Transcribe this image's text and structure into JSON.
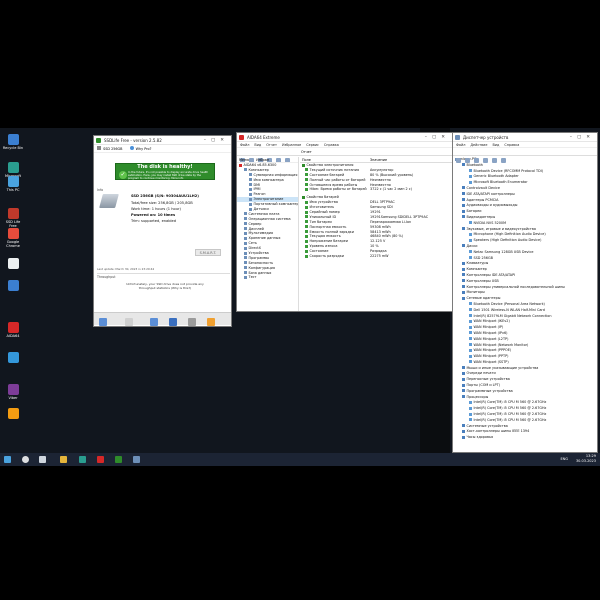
{
  "desktop_icons": [
    {
      "label": "Recycle Bin",
      "color": "#3b7fd1"
    },
    {
      "label": "Microsoft Edge",
      "color": "#2a9d8f"
    },
    {
      "label": "This PC",
      "color": "#4aa3df"
    },
    {
      "label": "SSD Life Free",
      "color": "#c0392b"
    },
    {
      "label": "Google Chrome",
      "color": "#e74c3c"
    },
    {
      "label": "",
      "color": "#ecf0f1"
    },
    {
      "label": "",
      "color": "#3b7fd1"
    },
    {
      "label": "AIDA64",
      "color": "#d62828"
    },
    {
      "label": "",
      "color": "#3498db"
    },
    {
      "label": "Viber",
      "color": "#7d3c98"
    },
    {
      "label": "",
      "color": "#f39c12"
    }
  ],
  "ssd_window": {
    "title": "SSDLife Free - version 2.5.82",
    "tabs": [
      "SSD 256GB",
      "Why Pro?"
    ],
    "status_title": "The disk is healthy!",
    "status_text": "In the future, it's not possible to display accurate drive health estimation. Here, you may install SSD drive state by the program to continue monitoring. More info",
    "info_label": "Info",
    "drive_name": "SSD 256GB (S/N: 90304AUU1LH2)",
    "total_free": "Total/free size: 256,8GB / 205,8GB",
    "work_time": "Work time: 1 hours (1 hour)",
    "powered_on": "Powered on: 10 times",
    "trim": "Trim: supported, enabled",
    "smart_btn": "S.M.A.R.T.",
    "last_update": "Last update: March 30, 2023 in 23:29:44",
    "throughput_label": "Throughput",
    "throughput_text": "Unfortunately, your SSD drive does not provide any throughput statistics (Why is this?)"
  },
  "aida_window": {
    "title": "AIDA64 Extreme",
    "menu": [
      "Файл",
      "Вид",
      "Отчет",
      "Избранное",
      "Сервис",
      "Справка"
    ],
    "left_tabs": [
      "Меню",
      "Избран"
    ],
    "tree": [
      "AIDA64 v6.85.6300",
      "Компьютер",
      "Суммарная информация",
      "Имя компьютера",
      "DMI",
      "IPMI",
      "Разгон",
      "Электропитание",
      "Портативный компьютер",
      "Датчики",
      "Системная плата",
      "Операционная система",
      "Сервер",
      "Дисплей",
      "Мультимедиа",
      "Хранение данных",
      "Сеть",
      "DirectX",
      "Устройства",
      "Программы",
      "Безопасность",
      "Конфигурация",
      "База данных",
      "Тест"
    ],
    "toolbar_label": "Отчет",
    "col_field": "Поле",
    "col_value": "Значение",
    "sections": [
      {
        "title": "Свойства электропитания",
        "rows": [
          [
            "Текущий источник питания",
            "Аккумулятор"
          ],
          [
            "Состояние батарей",
            "80 % (Высокий уровень)"
          ],
          [
            "Полный час работы от батарей",
            "Неизвестно"
          ],
          [
            "Оставшееся время работы",
            "Неизвестно"
          ],
          [
            "Hiber. Время работы от батарей",
            "3722 с (1 час 2 мин 2 с)"
          ]
        ]
      },
      {
        "title": "Свойства батарей",
        "rows": [
          [
            "Имя устройства",
            "DELL 3PTP9AC"
          ],
          [
            "Изготовитель",
            "Samsung SDI"
          ],
          [
            "Серийный номер",
            "19291"
          ],
          [
            "Уникальный ID",
            "19291Samsung SDIDELL 3PTP9AC"
          ],
          [
            "Тип батареи",
            "Перезаряжаемая Li-Ion"
          ],
          [
            "Паспортная емкость",
            "59308 mWh"
          ],
          [
            "Емкость полной зарядки",
            "58413 mWh"
          ],
          [
            "Текущая емкость",
            "46840 mWh  (80 %)"
          ],
          [
            "Напряжение батареи",
            "12.125 V"
          ],
          [
            "Уровень износа",
            "10 %"
          ],
          [
            "Состояние",
            "Разрядка"
          ],
          [
            "Скорость разрядки",
            "22275 mW"
          ]
        ]
      }
    ]
  },
  "devmgr_window": {
    "title": "Диспетчер устройств",
    "menu": [
      "Файл",
      "Действие",
      "Вид",
      "Справка"
    ],
    "tree": [
      {
        "t": "mloaw-PC",
        "lvl": 0
      },
      {
        "t": "Bluetooth",
        "lvl": 1
      },
      {
        "t": "Bluetooth Device (RFCOMM Protocol TDI)",
        "lvl": 2
      },
      {
        "t": "Generic Bluetooth Adapter",
        "lvl": 2
      },
      {
        "t": "Microsoft Bluetooth Enumerator",
        "lvl": 2
      },
      {
        "t": "Controlvault Device",
        "lvl": 1
      },
      {
        "t": "IDE ATA/ATAPI контроллеры",
        "lvl": 1
      },
      {
        "t": "Адаптеры PCMCIA",
        "lvl": 1
      },
      {
        "t": "Аудиовходы и аудиовыходы",
        "lvl": 1
      },
      {
        "t": "Батареи",
        "lvl": 1
      },
      {
        "t": "Видеоадаптеры",
        "lvl": 1
      },
      {
        "t": "NVIDIA NVS 5200M",
        "lvl": 2
      },
      {
        "t": "Звуковые, игровые и видеоустройства",
        "lvl": 1
      },
      {
        "t": "Microphone (High Definition Audio Device)",
        "lvl": 2
      },
      {
        "t": "Speakers (High Definition Audio Device)",
        "lvl": 2
      },
      {
        "t": "Диски",
        "lvl": 1
      },
      {
        "t": "Netac Samsung 128GB USB Device",
        "lvl": 2
      },
      {
        "t": "SSD 256GB",
        "lvl": 2
      },
      {
        "t": "Клавиатуры",
        "lvl": 1
      },
      {
        "t": "Компьютер",
        "lvl": 1
      },
      {
        "t": "Контроллеры IDE ATA/ATAPI",
        "lvl": 1
      },
      {
        "t": "Контроллеры USB",
        "lvl": 1
      },
      {
        "t": "Контроллеры универсальной последовательной шины",
        "lvl": 1
      },
      {
        "t": "Мониторы",
        "lvl": 1
      },
      {
        "t": "Сетевые адаптеры",
        "lvl": 1
      },
      {
        "t": "Bluetooth Device (Personal Area Network)",
        "lvl": 2
      },
      {
        "t": "Dell 1501 Wireless-N WLAN Half-Mini Card",
        "lvl": 2
      },
      {
        "t": "Intel(R) 82579LM Gigabit Network Connection",
        "lvl": 2
      },
      {
        "t": "WAN Miniport (IKEv2)",
        "lvl": 2
      },
      {
        "t": "WAN Miniport (IP)",
        "lvl": 2
      },
      {
        "t": "WAN Miniport (IPv6)",
        "lvl": 2
      },
      {
        "t": "WAN Miniport (L2TP)",
        "lvl": 2
      },
      {
        "t": "WAN Miniport (Network Monitor)",
        "lvl": 2
      },
      {
        "t": "WAN Miniport (PPPOE)",
        "lvl": 2
      },
      {
        "t": "WAN Miniport (PPTP)",
        "lvl": 2
      },
      {
        "t": "WAN Miniport (SSTP)",
        "lvl": 2
      },
      {
        "t": "Мыши и иные указывающие устройства",
        "lvl": 1
      },
      {
        "t": "Очереди печати",
        "lvl": 1
      },
      {
        "t": "Переносные устройства",
        "lvl": 1
      },
      {
        "t": "Порты (COM и LPT)",
        "lvl": 1
      },
      {
        "t": "Программные устройства",
        "lvl": 1
      },
      {
        "t": "Процессоры",
        "lvl": 1
      },
      {
        "t": "Intel(R) Core(TM) i5 CPU       M 560  @ 2.67GHz",
        "lvl": 2
      },
      {
        "t": "Intel(R) Core(TM) i5 CPU       M 560  @ 2.67GHz",
        "lvl": 2
      },
      {
        "t": "Intel(R) Core(TM) i5 CPU       M 560  @ 2.67GHz",
        "lvl": 2
      },
      {
        "t": "Intel(R) Core(TM) i5 CPU       M 560  @ 2.67GHz",
        "lvl": 2
      },
      {
        "t": "Системные устройства",
        "lvl": 1
      },
      {
        "t": "Хост-контроллеры шины IEEE 1394",
        "lvl": 1
      },
      {
        "t": "Часы здоровья",
        "lvl": 1
      }
    ]
  },
  "taskbar": {
    "time": "13:29",
    "date": "30.03.2023",
    "tray": "ENG"
  }
}
